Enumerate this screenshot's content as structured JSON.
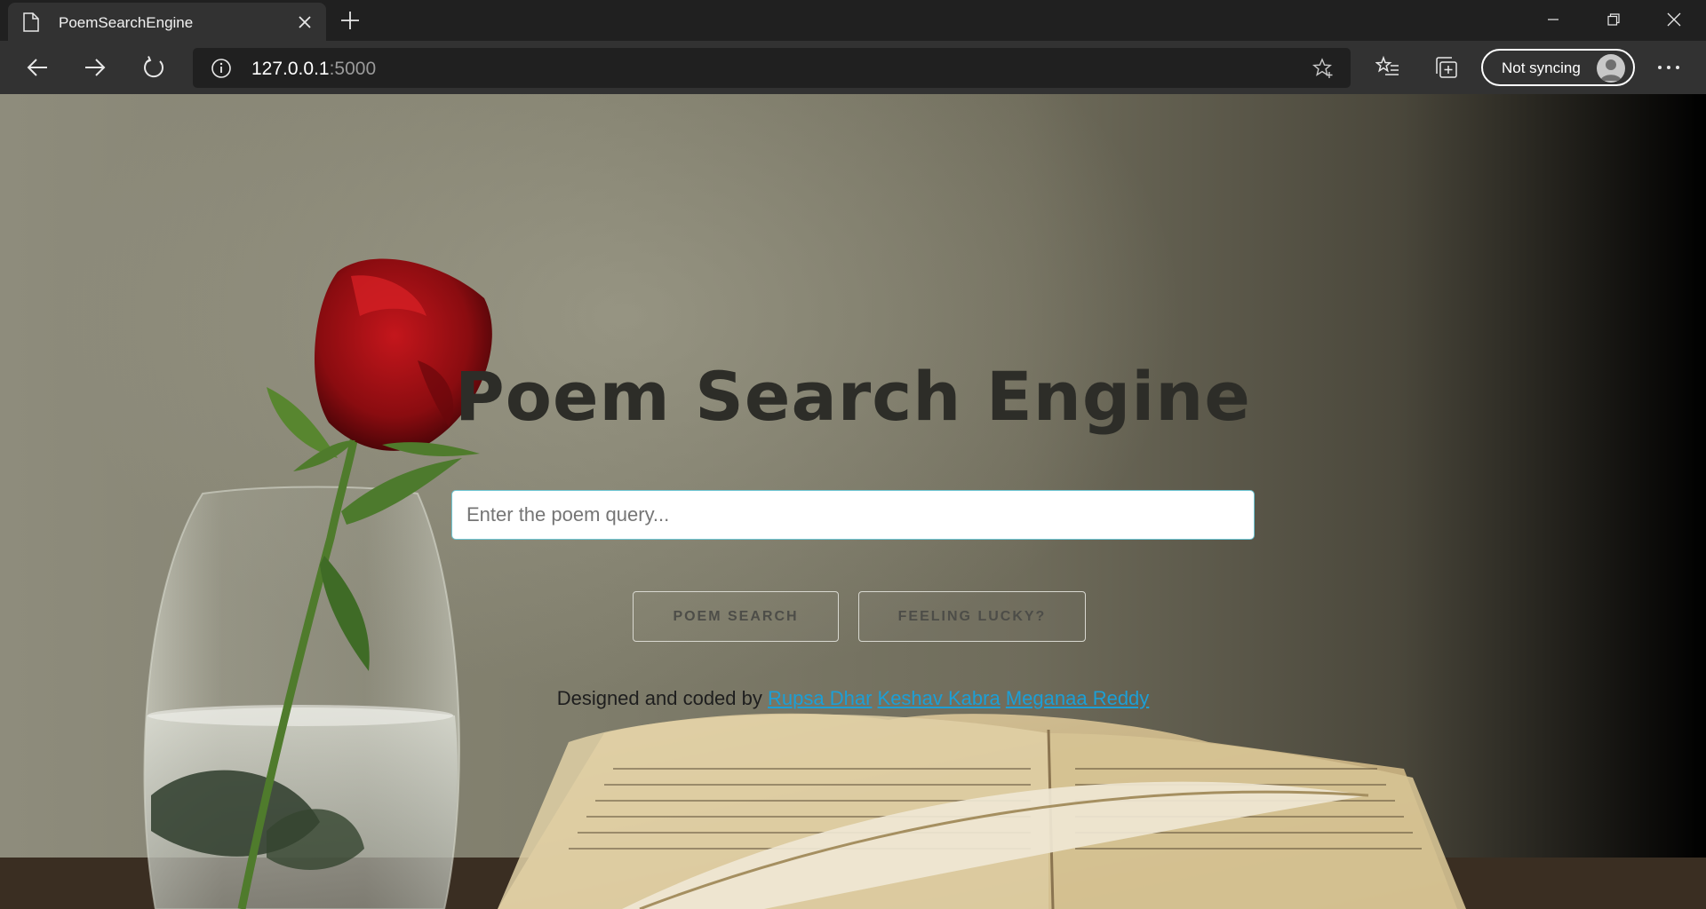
{
  "browser": {
    "tab_title": "PoemSearchEngine",
    "url_host": "127.0.0.1",
    "url_port": ":5000",
    "sync_label": "Not syncing"
  },
  "page": {
    "heading": "Poem Search Engine",
    "search_placeholder": "Enter the poem query...",
    "search_button": "POEM SEARCH",
    "lucky_button": "FEELING LUCKY?",
    "credits_prefix": "Designed and coded by",
    "authors": [
      "Rupsa Dhar",
      "Keshav Kabra",
      "Meganaa Reddy"
    ]
  },
  "colors": {
    "link": "#1c9fd6",
    "input_border": "#6ec6d4",
    "heading": "#2d2d28"
  },
  "icons": [
    "page-icon",
    "close-icon",
    "plus-icon",
    "minimize-icon",
    "restore-icon",
    "close-window-icon",
    "back-arrow-icon",
    "forward-arrow-icon",
    "refresh-icon",
    "info-icon",
    "star-add-icon",
    "favorites-icon",
    "collections-icon",
    "profile-avatar-icon",
    "more-icon"
  ]
}
